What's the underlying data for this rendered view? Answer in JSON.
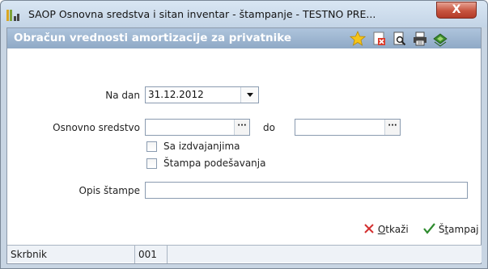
{
  "window": {
    "title": "SAOP Osnovna sredstva i sitan inventar - štampanje  - TESTNO PRE...",
    "close_glyph": "X"
  },
  "header": {
    "title": "Obračun vrednosti amortizacije za privatnike",
    "toolbar_icons": [
      "favorite-star-icon",
      "close-report-icon",
      "print-preview-icon",
      "printer-icon",
      "export-icon"
    ]
  },
  "form": {
    "na_dan": {
      "label": "Na dan",
      "value": "31.12.2012"
    },
    "osnovno_sredstvo": {
      "label": "Osnovno sredstvo",
      "from_value": "",
      "to_label": "do",
      "to_value": "",
      "browse_glyph": "···"
    },
    "sa_izdvajanjima": {
      "label": "Sa izdvajanjima",
      "checked": false
    },
    "stampa_podesavanja": {
      "label": "Štampa podešavanja",
      "checked": false
    },
    "opis_stampe": {
      "label": "Opis štampe",
      "value": ""
    }
  },
  "actions": {
    "cancel": {
      "pre": "",
      "underlined": "O",
      "post": "tkaži"
    },
    "print": {
      "pre": "Š",
      "underlined": "t",
      "post": "ampaj"
    }
  },
  "statusbar": {
    "user": "Skrbnik",
    "code": "001",
    "extra": ""
  },
  "colors": {
    "header_band": "#9cb5d1",
    "cancel_icon": "#d32f2f",
    "print_icon": "#2e8b2e",
    "close_button": "#c7543f"
  }
}
